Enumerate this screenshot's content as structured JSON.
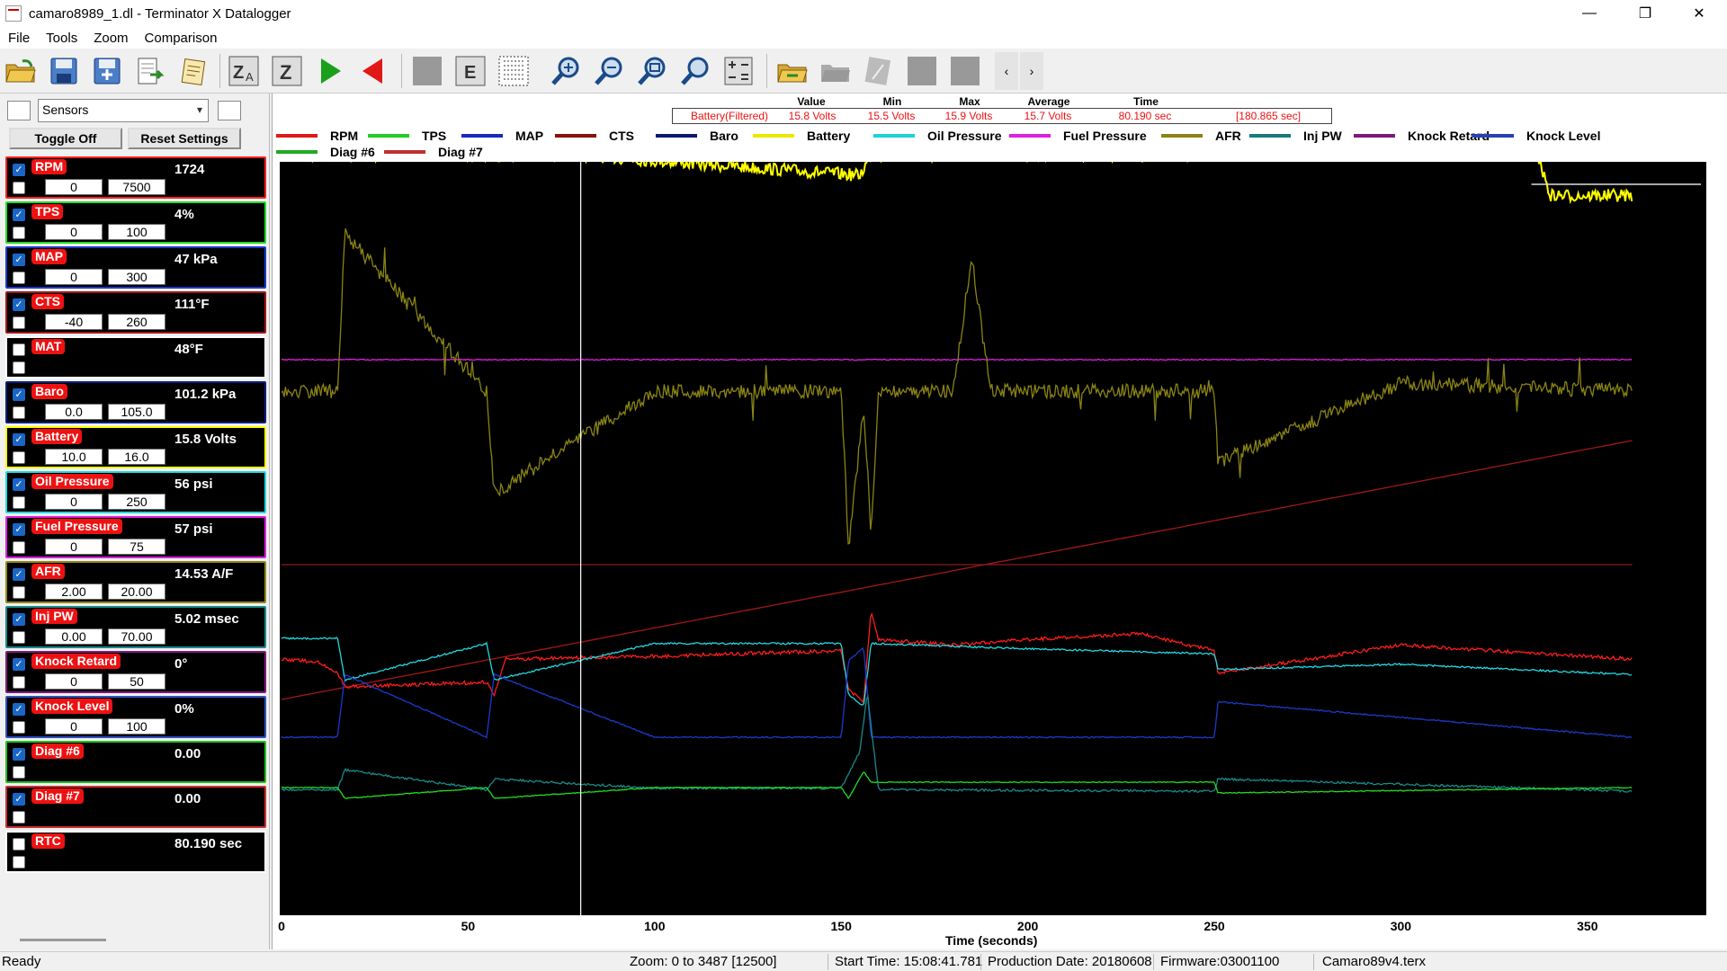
{
  "window": {
    "title": "camaro8989_1.dl - Terminator X Datalogger",
    "minimize": "—",
    "restore": "❐",
    "close": "✕"
  },
  "menu": [
    "File",
    "Tools",
    "Zoom",
    "Comparison"
  ],
  "toolbar": {
    "buttons": [
      "open-icon",
      "save-icon",
      "save-as-icon",
      "export-icon",
      "notes-icon",
      "za-icon",
      "z-icon",
      "play-icon",
      "reverse-icon",
      "blank-icon",
      "e-icon",
      "grid-icon",
      "zoom-in-icon",
      "zoom-out-icon",
      "zoom-fit-icon",
      "zoom-reset-icon",
      "calc-icon",
      "folder-compare-icon",
      "compare-disabled-icon",
      "compare-edit-disabled-icon",
      "disabled-icon-1",
      "disabled-icon-2"
    ],
    "scroll_left": "‹",
    "scroll_right": "›"
  },
  "sidebar": {
    "dropdown": "Sensors",
    "toggle_off": "Toggle Off",
    "reset_settings": "Reset Settings",
    "sensors": [
      {
        "name": "RPM",
        "value": "1724",
        "min": "0",
        "max": "7500",
        "checked": true,
        "color": "#ff2020"
      },
      {
        "name": "TPS",
        "value": "4%",
        "min": "0",
        "max": "100",
        "checked": true,
        "color": "#22dd22"
      },
      {
        "name": "MAP",
        "value": "47 kPa",
        "min": "0",
        "max": "300",
        "checked": true,
        "color": "#1a3acc"
      },
      {
        "name": "CTS",
        "value": "111°F",
        "min": "-40",
        "max": "260",
        "checked": true,
        "color": "#a01818"
      },
      {
        "name": "MAT",
        "value": "48°F",
        "min": "",
        "max": "",
        "checked": false,
        "color": "#ffffff"
      },
      {
        "name": "Baro",
        "value": "101.2 kPa",
        "min": "0.0",
        "max": "105.0",
        "checked": true,
        "color": "#0a2080"
      },
      {
        "name": "Battery",
        "value": "15.8 Volts",
        "min": "10.0",
        "max": "16.0",
        "checked": true,
        "color": "#ffff00"
      },
      {
        "name": "Oil Pressure",
        "value": "56 psi",
        "min": "0",
        "max": "250",
        "checked": true,
        "color": "#22d8e0"
      },
      {
        "name": "Fuel Pressure",
        "value": "57 psi",
        "min": "0",
        "max": "75",
        "checked": true,
        "color": "#e020e0"
      },
      {
        "name": "AFR",
        "value": "14.53 A/F",
        "min": "2.00",
        "max": "20.00",
        "checked": true,
        "color": "#908a18"
      },
      {
        "name": "Inj PW",
        "value": "5.02 msec",
        "min": "0.00",
        "max": "70.00",
        "checked": true,
        "color": "#1a8a8a"
      },
      {
        "name": "Knock Retard",
        "value": "0°",
        "min": "0",
        "max": "50",
        "checked": true,
        "color": "#801a80"
      },
      {
        "name": "Knock Level",
        "value": "0%",
        "min": "0",
        "max": "100",
        "checked": true,
        "color": "#3050c0"
      },
      {
        "name": "Diag #6",
        "value": "0.00",
        "min": "",
        "max": "",
        "checked": true,
        "color": "#22c022"
      },
      {
        "name": "Diag #7",
        "value": "0.00",
        "min": "",
        "max": "",
        "checked": true,
        "color": "#cc3030"
      },
      {
        "name": "RTC",
        "value": "80.190 sec",
        "min": "",
        "max": "",
        "checked": false,
        "color": "#ffffff"
      }
    ]
  },
  "stats": {
    "headers": [
      "Value",
      "Min",
      "Max",
      "Average",
      "Time"
    ],
    "sensor": "Battery(Filtered)",
    "value": "15.8 Volts",
    "min": "15.5 Volts",
    "max": "15.9 Volts",
    "average": "15.7 Volts",
    "time": "80.190 sec",
    "total": "[180.865 sec]"
  },
  "legend": [
    {
      "name": "RPM",
      "color": "#e01818"
    },
    {
      "name": "TPS",
      "color": "#22cc22"
    },
    {
      "name": "MAP",
      "color": "#1a28c0"
    },
    {
      "name": "CTS",
      "color": "#8a1010"
    },
    {
      "name": "Baro",
      "color": "#0a1a70"
    },
    {
      "name": "Battery",
      "color": "#eaea00"
    },
    {
      "name": "Oil Pressure",
      "color": "#22d0d8"
    },
    {
      "name": "Fuel Pressure",
      "color": "#e020e0"
    },
    {
      "name": "AFR",
      "color": "#8a8414"
    },
    {
      "name": "Inj PW",
      "color": "#1a7a7a"
    },
    {
      "name": "Knock Retard",
      "color": "#7a1a7a"
    },
    {
      "name": "Knock Level",
      "color": "#2a40b0"
    },
    {
      "name": "Diag #6",
      "color": "#22aa22"
    },
    {
      "name": "Diag #7",
      "color": "#c03030"
    }
  ],
  "chart_data": {
    "type": "line",
    "xlabel": "Time (seconds)",
    "xlim": [
      0,
      380
    ],
    "xticks": [
      0,
      50,
      100,
      150,
      200,
      250,
      300,
      350
    ],
    "cursor_time": 80.19,
    "data_end": 362,
    "grid": false,
    "series": [
      {
        "name": "Battery",
        "color": "#ffff00",
        "x": [
          0,
          80,
          155,
          158,
          250,
          300,
          335,
          340,
          362
        ],
        "y": [
          15.8,
          15.8,
          15.7,
          15.8,
          15.8,
          15.9,
          15.9,
          15.6,
          15.6
        ]
      },
      {
        "name": "Fuel Pressure",
        "color": "#e020e0",
        "x": [
          0,
          362
        ],
        "y": [
          57,
          56
        ]
      },
      {
        "name": "AFR",
        "color": "#8a8414",
        "x": [
          0,
          15,
          17,
          55,
          57,
          100,
          150,
          152,
          156,
          158,
          160,
          180,
          185,
          190,
          250,
          251,
          300,
          362
        ],
        "y": [
          14.5,
          14.5,
          16.5,
          14.5,
          13.2,
          14.5,
          14.5,
          12.5,
          14.3,
          12.7,
          14.5,
          14.5,
          16.2,
          14.5,
          14.5,
          13.6,
          14.6,
          14.5
        ]
      },
      {
        "name": "CTS",
        "color": "#a01818",
        "x": [
          0,
          362
        ],
        "y": [
          60,
          190
        ]
      },
      {
        "name": "Knock Retard",
        "color": "#8a1c1c",
        "x": [
          0,
          362
        ],
        "y": [
          0,
          0
        ]
      },
      {
        "name": "RPM",
        "color": "#ff1c1c",
        "x": [
          0,
          10,
          15,
          17,
          55,
          57,
          60,
          100,
          150,
          152,
          156,
          158,
          160,
          180,
          200,
          230,
          250,
          251,
          300,
          362
        ],
        "y": [
          1725,
          1700,
          1600,
          1480,
          1520,
          1400,
          1725,
          1750,
          1800,
          1450,
          1350,
          2150,
          1900,
          1850,
          1900,
          1950,
          1800,
          1600,
          1850,
          1725
        ]
      },
      {
        "name": "Oil Pressure",
        "color": "#22d8e0",
        "x": [
          0,
          15,
          17,
          55,
          57,
          100,
          150,
          152,
          156,
          158,
          200,
          250,
          251,
          300,
          362
        ],
        "y": [
          63,
          63,
          55,
          62,
          55,
          62,
          62,
          52,
          50,
          62,
          61,
          60,
          57,
          58,
          56
        ]
      },
      {
        "name": "MAP",
        "color": "#1a3acc",
        "x": [
          0,
          15,
          17,
          55,
          57,
          100,
          150,
          152,
          156,
          158,
          200,
          250,
          251,
          362
        ],
        "y": [
          47,
          47,
          70,
          47,
          70,
          47,
          47,
          75,
          80,
          47,
          47,
          47,
          60,
          47
        ]
      },
      {
        "name": "Inj PW",
        "color": "#1a8a8a",
        "x": [
          0,
          15,
          17,
          55,
          57,
          100,
          150,
          155,
          157,
          160,
          250,
          251,
          362
        ],
        "y": [
          5.1,
          5.1,
          6.4,
          5.1,
          5.8,
          5.2,
          5.2,
          7.6,
          11.5,
          5.1,
          5.0,
          5.8,
          5.0
        ]
      },
      {
        "name": "TPS",
        "color": "#22dd22",
        "x": [
          0,
          15,
          17,
          55,
          57,
          100,
          150,
          152,
          156,
          158,
          250,
          251,
          362
        ],
        "y": [
          4,
          4,
          2,
          4,
          2,
          4,
          4,
          2,
          7,
          5,
          5,
          3,
          4
        ]
      }
    ]
  },
  "statusbar": {
    "ready": "Ready",
    "zoom": "Zoom: 0 to 3487 [12500]",
    "start_time": "Start Time: 15:08:41.781",
    "production_date": "Production Date: 20180608",
    "firmware": "Firmware:03001100",
    "tune": "Camaro89v4.terx"
  }
}
